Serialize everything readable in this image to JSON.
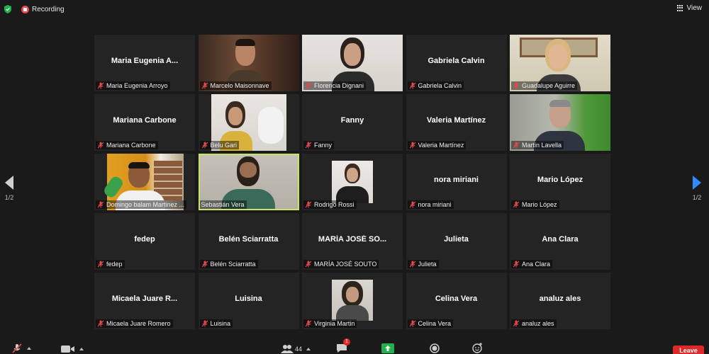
{
  "topbar": {
    "recording_label": "Recording",
    "view_label": "View"
  },
  "nav": {
    "left_page": "1/2",
    "right_page": "1/2"
  },
  "colors": {
    "active_outline": "#c9e36a",
    "muted_red": "#e5484d",
    "accent_blue": "#2d8cff",
    "leave_red": "#e02828"
  },
  "participants": [
    {
      "title": "Maria Eugenia A...",
      "name": "Maria Eugenia Arroyo"
    },
    {
      "name": "Marcelo Maisonnave"
    },
    {
      "name": "Florencia Dignani"
    },
    {
      "title": "Gabriela Calvin",
      "name": "Gabriela Calvin"
    },
    {
      "name": "Guadalupe Aguirre"
    },
    {
      "title": "Mariana Carbone",
      "name": "Mariana Carbone"
    },
    {
      "name": "Belu Gari"
    },
    {
      "title": "Fanny",
      "name": "Fanny"
    },
    {
      "title": "Valeria Martínez",
      "name": "Valeria Martínez"
    },
    {
      "name": "Martin Lavella"
    },
    {
      "name": "Domingo balam Martinez ..."
    },
    {
      "name": "Sebastián Vera"
    },
    {
      "name": "Rodrigo Rossi"
    },
    {
      "title": "nora miriani",
      "name": "nora miriani"
    },
    {
      "title": "Mario López",
      "name": "Mario López"
    },
    {
      "title": "fedep",
      "name": "fedep"
    },
    {
      "title": "Belén Sciarratta",
      "name": "Belén Sciarratta"
    },
    {
      "title": "MARÍA JOSÉ SO...",
      "name": "MARÍA JOSÉ SOUTO"
    },
    {
      "title": "Julieta",
      "name": "Julieta"
    },
    {
      "title": "Ana Clara",
      "name": "Ana Clara"
    },
    {
      "title": "Micaela Juare R...",
      "name": "Micaela Juare Romero"
    },
    {
      "title": "Luisina",
      "name": "Luisina"
    },
    {
      "name": "Virginia Martin"
    },
    {
      "title": "Celina Vera",
      "name": "Celina Vera"
    },
    {
      "title": "analuz ales",
      "name": "analuz ales"
    }
  ],
  "toolbar": {
    "participants_count": "44",
    "chat_badge": "1",
    "leave_label": "Leave"
  },
  "icons": [
    "shield-icon",
    "recording-icon",
    "grid-view-icon",
    "mic-muted-icon",
    "video-camera-icon",
    "participants-icon",
    "chat-icon",
    "share-screen-icon",
    "record-icon",
    "reactions-icon",
    "chevron-left-icon",
    "chevron-right-icon"
  ]
}
